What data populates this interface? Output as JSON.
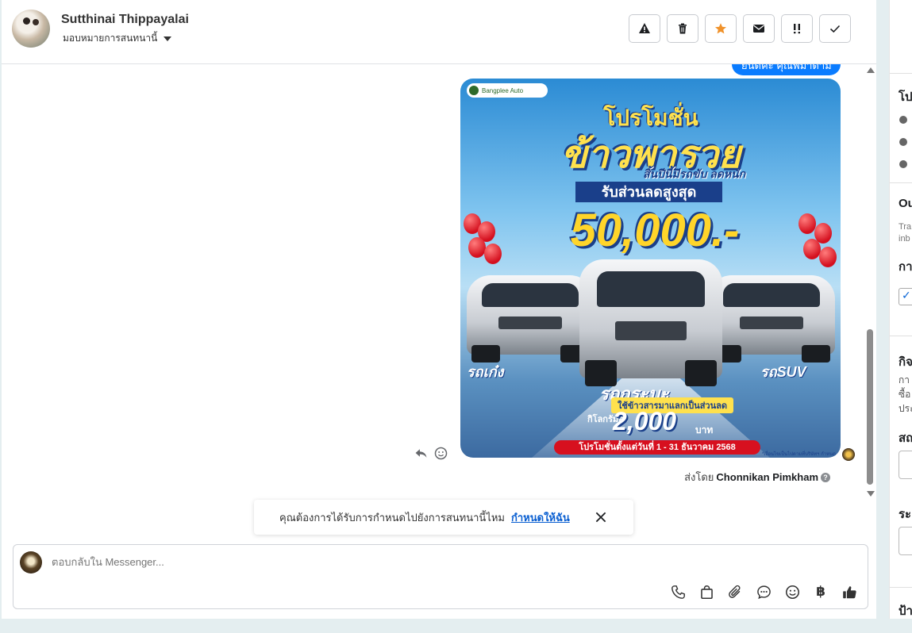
{
  "header": {
    "contact_name": "Sutthinai Thippayalai",
    "assign_label": "มอบหมายการสนทนานี้"
  },
  "toolbar": {
    "buttons": [
      "warning-icon",
      "trash-icon",
      "star-icon",
      "envelope-icon",
      "double-exclamation-icon",
      "check-icon"
    ],
    "accent": "#f0922b"
  },
  "chat": {
    "top_bubble": "ยินดีค่ะ คุณพี่มาดาม",
    "promo": {
      "brand": "Bangplee Auto",
      "heading": "โปรโมชั่น",
      "title": "ข้าวพารวย",
      "subtitle": "สิ้นปีนี้มีรถขับ ลดหนัก",
      "band": "รับส่วนลดสูงสุด",
      "amount": "50,000.-",
      "label_left": "รถเก๋ง",
      "label_right": "รถSUV",
      "label_mid": "รถกระบะ",
      "rice_exchange": "ใช้ข้าวสารมาแลกเป็นส่วนลด",
      "per_kg": "กิโลกรัมละ",
      "kg_amount": "2,000",
      "kg_unit": "บาท",
      "footer": "โปรโมชั่นตั้งแต่วันที่ 1 - 31 ธันวาคม 2568",
      "fine_print": "*เงื่อนไขเป็นไปตามที่บริษัทฯ กำหนด"
    },
    "sent_by_prefix": "ส่งโดย",
    "sent_by_name": "Chonnikan Pimkham"
  },
  "assign_banner": {
    "question": "คุณต้องการได้รับการกำหนดไปยังการสนทนานี้ไหม",
    "link": "กำหนดให้ฉัน"
  },
  "composer": {
    "placeholder": "ตอบกลับใน Messenger...",
    "baht_symbol": "฿"
  },
  "right_panel": {
    "s1": "โป",
    "s2": "Ou",
    "s2_desc_1": "Tra",
    "s2_desc_2": "inb",
    "s3": "กา",
    "s4": "กิจ",
    "s4_line1": "กา",
    "s4_line2": "ซื้อ",
    "s4_line3": "ประ",
    "s5": "สถ",
    "s6": "ระ",
    "s7": "ป้า"
  }
}
